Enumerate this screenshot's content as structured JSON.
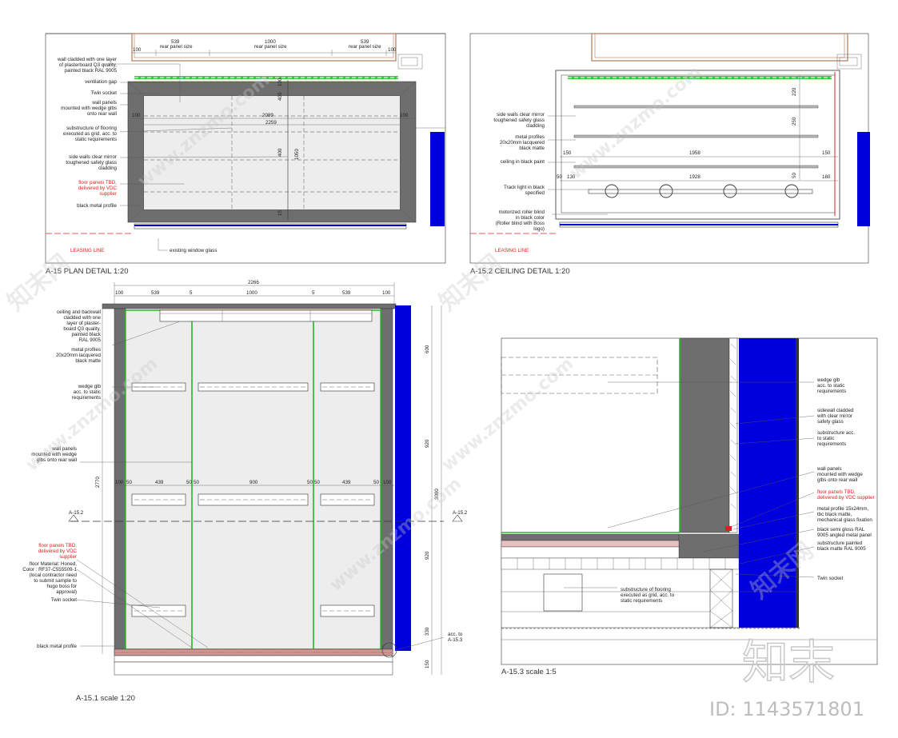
{
  "titles": {
    "plan": "A-15 PLAN DETAIL 1:20",
    "ceiling": "A-15.2 CEILING DETAIL 1:20",
    "elevation": "A-15.1 scale 1:20",
    "section": "A-15.3 scale 1:5"
  },
  "plan": {
    "dims": [
      "100",
      "539",
      "1000",
      "539",
      "100",
      "2089",
      "2259",
      "100",
      "100",
      "100",
      "400",
      "1050",
      "400",
      "15"
    ],
    "dim_subs": [
      "rear panel size",
      "rear panel size",
      "rear panel size"
    ],
    "labels": [
      "wall cladded with one layer",
      "of plasterboard Q3 quality,",
      "painted black RAL 9005",
      "ventilation gap",
      "Twin socket",
      "wall panels",
      "mounted with wedge glbs",
      "onto rear wall",
      "substructure of flooring",
      "executed as grid, acc. to",
      "static requirements",
      "side walls clear mirror",
      "toughened safety glass",
      "cladding",
      "black metal profile",
      "existing window glass"
    ],
    "red_labels": [
      "floor panels TBD,",
      "delivered by VDC",
      "supplier",
      "LEASING LINE"
    ]
  },
  "ceiling": {
    "dims": [
      "220",
      "250",
      "150",
      "1958",
      "150",
      "1928",
      "50",
      "130",
      "180",
      "50"
    ],
    "labels": [
      "side walls clear mirror",
      "toughened safety glass",
      "cladding",
      "metal profiles",
      "20x20mm lacquered",
      "black matte",
      "ceiling in black paint",
      "Track light in black",
      "specified",
      "motorized roller blind",
      "in black color",
      "(Roller blind with Boss",
      "logo)"
    ],
    "red_labels": [
      "LEASING LINE"
    ]
  },
  "elevation": {
    "dims": [
      "2266",
      "100",
      "539",
      "5",
      "1000",
      "5",
      "539",
      "100",
      "2770",
      "3000",
      "600",
      "920",
      "920",
      "330",
      "150",
      "100",
      "50",
      "439",
      "50",
      "50",
      "900",
      "50",
      "50",
      "439",
      "50",
      "100"
    ],
    "markers": [
      "A-15.2",
      "A-15.2"
    ],
    "labels": [
      "ceiling and backwall",
      "cladded with one",
      "layer of plaster-",
      "board Q3 quality,",
      "painted black",
      "RAL 9005",
      "metal profiles",
      "20x20mm lacquered",
      "black matte",
      "wedge glb",
      "acc. to static",
      "requirements",
      "wall panels",
      "mounted with wedge",
      "glbs onto rear wall",
      "floor Material: Honed,",
      "Color : RF37-C555509-1",
      "(local contractor need",
      "to submit sample to",
      "hugo boss for",
      "approval)",
      "Twin socket",
      "black metal profile",
      "acc. to",
      "A-15.3"
    ],
    "red_labels": [
      "floor panels TBD,",
      "delivered by VDC",
      "supplier"
    ]
  },
  "section": {
    "labels": [
      "wedge glb",
      "acc. to static",
      "requirements",
      "sidewall cladded",
      "with clear mirror",
      "safety glass",
      "substructure acc.",
      "to static",
      "requirements",
      "wall panels",
      "mounted with wedge",
      "glbs onto rear wall",
      "metal profile 15x24mm,",
      "tbc black matte,",
      "mechanical glass fixation",
      "black semi gloss RAL",
      "9005 angled metal panel",
      "substructure painted",
      "black matte RAL 9005",
      "Twin socket",
      "substructure of flooring",
      "executed as grid, acc. to",
      "static requirements"
    ],
    "red_labels": [
      "floor panels TBD,",
      "delivered by VDC supplier"
    ]
  },
  "watermark": {
    "text": "www.znzmo.com",
    "brand": "知末网",
    "logo": "知末",
    "id_text": "ID: 1143571801"
  },
  "colors": {
    "blue": "#0000dd",
    "green": "#22bb22",
    "grey": "#6e6e6e",
    "panel": "#ededed",
    "red": "#e02020",
    "brown": "#b07a5a"
  }
}
